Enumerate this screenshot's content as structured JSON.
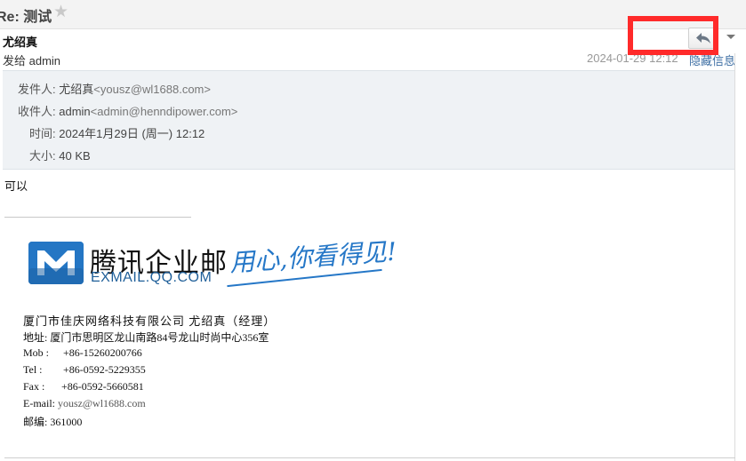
{
  "header": {
    "subject": "Re: 测试",
    "star_icon": "star-icon"
  },
  "sender": {
    "name": "尤绍真",
    "sent_to": "发给 admin",
    "datetime": "2024-01-29 12:12",
    "hide_info": "隐藏信息"
  },
  "toolbar": {
    "reply_icon": "reply-icon",
    "more_icon": "chevron-down-icon"
  },
  "details": {
    "from_label": "发件人:",
    "from_name": "尤绍真",
    "from_email": "<yousz@wl1688.com>",
    "to_label": "收件人:",
    "to_name": "admin",
    "to_email": "<admin@henndipower.com>",
    "time_label": "时间:",
    "time_value": "2024年1月29日 (周一) 12:12",
    "size_label": "大小:",
    "size_value": "40 KB"
  },
  "body": {
    "text": "可以"
  },
  "signature": {
    "logo_cn": "腾讯企业邮",
    "logo_en": "EXMAIL.QQ.COM",
    "slogan": "用心,你看得见!",
    "company_line": "厦门市佳庆网络科技有限公司 尤绍真（经理）",
    "address": "地址: 厦门市思明区龙山南路84号龙山时尚中心356室",
    "mob_label": "Mob :",
    "mob_value": "+86-15260200766",
    "tel_label": "Tel :",
    "tel_value": "+86-0592-5229355",
    "fax_label": "Fax :",
    "fax_value": "+86-0592-5660581",
    "email_label": "E-mail:",
    "email_value": "yousz@wl1688.com",
    "postcode": "邮编: 361000"
  },
  "colors": {
    "highlight": "#ff2a2a",
    "link": "#3d6ea3",
    "brand_blue": "#2476c4"
  }
}
